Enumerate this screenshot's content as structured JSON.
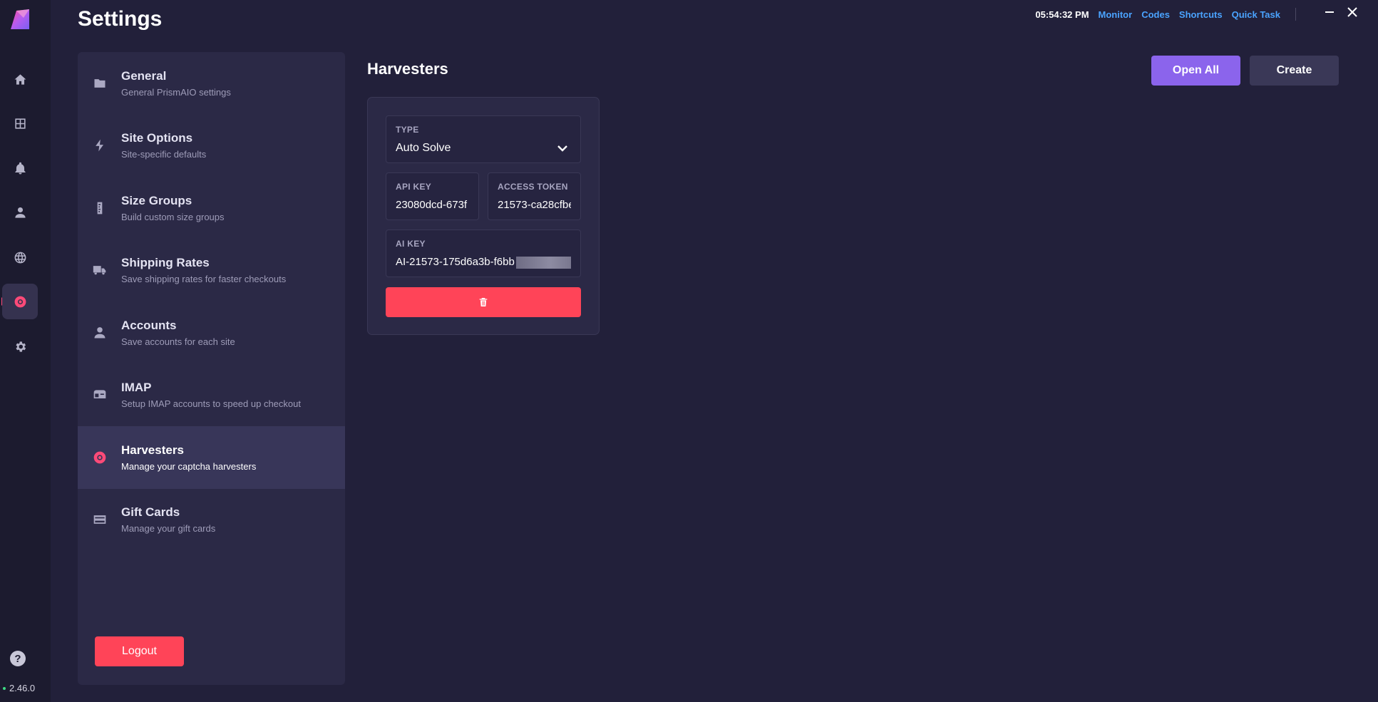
{
  "page": {
    "title": "Settings"
  },
  "topbar": {
    "clock": "05:54:32 PM",
    "links": [
      "Monitor",
      "Codes",
      "Shortcuts",
      "Quick Task"
    ]
  },
  "rail": {
    "icons": [
      "home-icon",
      "grid-icon",
      "bell-icon",
      "user-icon",
      "globe-icon",
      "chrome-icon",
      "gear-icon"
    ],
    "active": "chrome-icon",
    "help": "?",
    "version": "2.46.0"
  },
  "menu": {
    "items": [
      {
        "title": "General",
        "subtitle": "General PrismAIO settings",
        "icon": "folder-icon"
      },
      {
        "title": "Site Options",
        "subtitle": "Site-specific defaults",
        "icon": "bolt-icon"
      },
      {
        "title": "Size Groups",
        "subtitle": "Build custom size groups",
        "icon": "ruler-icon"
      },
      {
        "title": "Shipping Rates",
        "subtitle": "Save shipping rates for faster checkouts",
        "icon": "truck-icon"
      },
      {
        "title": "Accounts",
        "subtitle": "Save accounts for each site",
        "icon": "user-icon"
      },
      {
        "title": "IMAP",
        "subtitle": "Setup IMAP accounts to speed up checkout",
        "icon": "mailbox-icon"
      },
      {
        "title": "Harvesters",
        "subtitle": "Manage your captcha harvesters",
        "icon": "chrome-icon"
      },
      {
        "title": "Gift Cards",
        "subtitle": "Manage your gift cards",
        "icon": "credit-card-icon"
      }
    ],
    "active": "Harvesters",
    "logout_label": "Logout"
  },
  "content": {
    "title": "Harvesters",
    "open_all_label": "Open All",
    "create_label": "Create",
    "harvester": {
      "type_label": "TYPE",
      "type_value": "Auto Solve",
      "api_key_label": "API KEY",
      "api_key_value": "23080dcd-673f",
      "access_token_label": "ACCESS TOKEN",
      "access_token_value": "21573-ca28cfbe",
      "ai_key_label": "AI KEY",
      "ai_key_value": "AI-21573-175d6a3b-f6bb"
    }
  },
  "colors": {
    "accent_pink": "#ff4a78",
    "danger": "#ff4458",
    "primary_purple": "#8b64ec",
    "link_blue": "#4aa3ff"
  }
}
